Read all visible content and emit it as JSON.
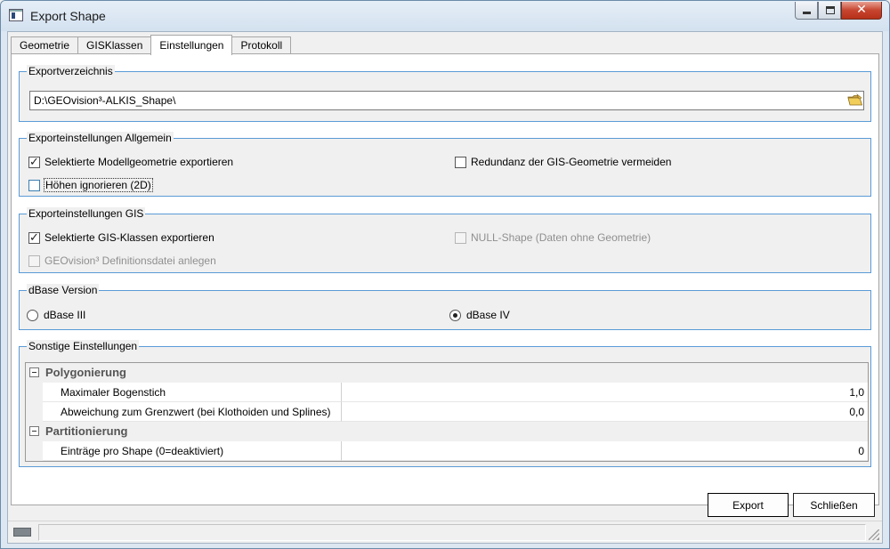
{
  "window": {
    "title": "Export Shape"
  },
  "tabs": [
    {
      "label": "Geometrie"
    },
    {
      "label": "GISKlassen"
    },
    {
      "label": "Einstellungen"
    },
    {
      "label": "Protokoll"
    }
  ],
  "export_dir": {
    "legend": "Exportverzeichnis",
    "path": "D:\\GEOvision³-ALKIS_Shape\\"
  },
  "general": {
    "legend": "Exporteinstellungen Allgemein",
    "opt_model_geometry": {
      "label": "Selektierte Modellgeometrie exportieren",
      "checked": true
    },
    "opt_redundancy": {
      "label": "Redundanz der GIS-Geometrie vermeiden",
      "checked": false
    },
    "opt_ignore_heights": {
      "label": "Höhen ignorieren (2D)",
      "checked": false
    }
  },
  "gis": {
    "legend": "Exporteinstellungen GIS",
    "opt_gis_classes": {
      "label": "Selektierte GIS-Klassen exportieren",
      "checked": true
    },
    "opt_null_shape": {
      "label": "NULL-Shape (Daten ohne Geometrie)",
      "checked": false,
      "enabled": false
    },
    "opt_definition_file": {
      "label": "GEOvision³ Definitionsdatei anlegen",
      "checked": false,
      "enabled": false
    }
  },
  "dbase": {
    "legend": "dBase Version",
    "opt_dbase3": {
      "label": "dBase III",
      "selected": false
    },
    "opt_dbase4": {
      "label": "dBase IV",
      "selected": true
    }
  },
  "other": {
    "legend": "Sonstige Einstellungen",
    "cat_polygon": {
      "label": "Polygonierung"
    },
    "row_arc": {
      "name": "Maximaler Bogenstich",
      "value": "1,0"
    },
    "row_deviation": {
      "name": "Abweichung zum Grenzwert (bei Klothoiden und Splines)",
      "value": "0,0"
    },
    "cat_partition": {
      "label": "Partitionierung"
    },
    "row_entries": {
      "name": "Einträge pro Shape (0=deaktiviert)",
      "value": "0"
    }
  },
  "buttons": {
    "export": "Export",
    "close": "Schließen"
  },
  "status": {
    "text": ""
  }
}
